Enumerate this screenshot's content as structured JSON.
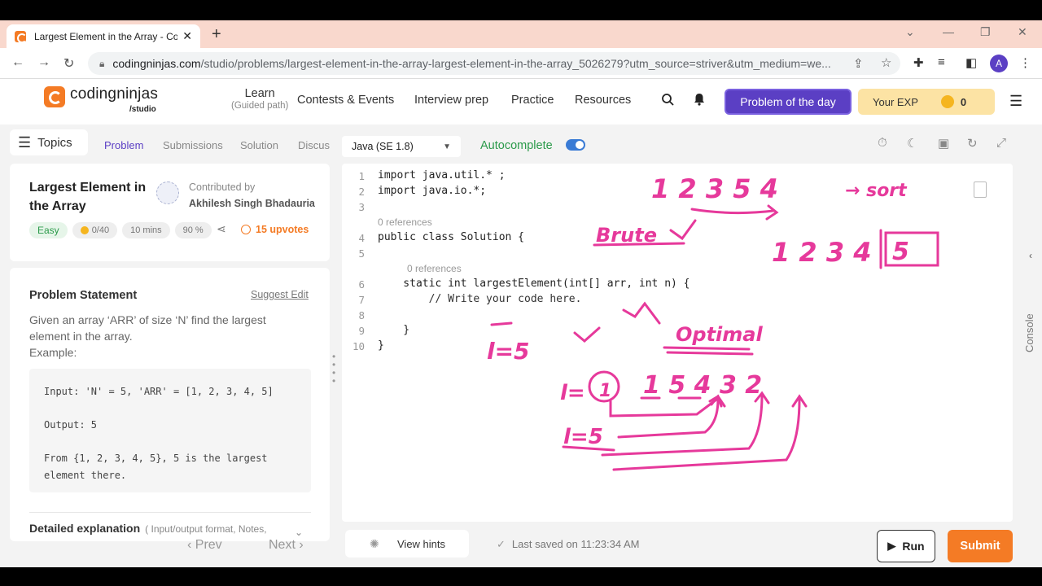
{
  "browser": {
    "tab_title": "Largest Element in the Array - Co",
    "url_domain": "codingninjas.com",
    "url_path": "/studio/problems/largest-element-in-the-array-largest-element-in-the-array_5026279?utm_source=striver&utm_medium=we...",
    "avatar_letter": "A"
  },
  "header": {
    "logo_text": "codingninjas",
    "logo_sub": "/studio",
    "nav": {
      "learn": "Learn",
      "learn_sub": "(Guided path)",
      "contests": "Contests & Events",
      "interview": "Interview prep",
      "practice": "Practice",
      "resources": "Resources"
    },
    "potd": "Problem of the day",
    "exp_label": "Your EXP",
    "exp_value": "0"
  },
  "left": {
    "topics": "Topics",
    "tabs": [
      "Problem",
      "Submissions",
      "Solution",
      "Discus"
    ],
    "problem_title": "Largest Element in the Array",
    "contributed_label": "Contributed by",
    "contributor": "Akhilesh Singh Bhadauria",
    "difficulty": "Easy",
    "score": "0/40",
    "time": "10 mins",
    "success": "90 %",
    "upvotes": "15 upvotes",
    "statement_title": "Problem Statement",
    "suggest_edit": "Suggest Edit",
    "description": "Given an array ‘ARR’ of size ‘N’ find the largest element in the array.",
    "example_label": "Example:",
    "example_text": "Input: 'N' = 5, 'ARR' = [1, 2, 3, 4, 5]\n\nOutput: 5\n\nFrom {1, 2, 3, 4, 5}, 5 is the largest\nelement there.",
    "detailed": "Detailed explanation",
    "detailed_sub": "( Input/output format, Notes,"
  },
  "editor": {
    "language": "Java (SE 1.8)",
    "autocomplete": "Autocomplete",
    "autocomplete_on": true,
    "lines": [
      {
        "n": "1",
        "text": "import java.util.* ;"
      },
      {
        "n": "2",
        "text": "import java.io.*;"
      },
      {
        "n": "3",
        "text": ""
      },
      {
        "n": "4",
        "text": "public class Solution {"
      },
      {
        "n": "5",
        "text": ""
      },
      {
        "n": "6",
        "text": "    static int largestElement(int[] arr, int n) {"
      },
      {
        "n": "7",
        "text": "        // Write your code here."
      },
      {
        "n": "8",
        "text": ""
      },
      {
        "n": "9",
        "text": "    }"
      },
      {
        "n": "10",
        "text": "}"
      }
    ],
    "ref1": "0 references",
    "ref2": "0 references",
    "console": "Console"
  },
  "annotations": {
    "seq1": "1 2 3 5 4",
    "sort": "→ sort",
    "brute": "Brute",
    "seq2": "1 2 3 4",
    "boxed": "5",
    "l5a": "l=5",
    "optimal": "Optimal",
    "l1": "l=",
    "circled": "1",
    "seq3": "1  5  4  3  2",
    "l5b": "l=5"
  },
  "footer": {
    "prev": "Prev",
    "next": "Next",
    "hints": "View hints",
    "saved": "Last saved on 11:23:34 AM",
    "run": "Run",
    "submit": "Submit"
  },
  "colors": {
    "accent": "#5b3fc4",
    "orange": "#f47b25",
    "ink": "#e6399b",
    "green": "#2b9a4a"
  }
}
